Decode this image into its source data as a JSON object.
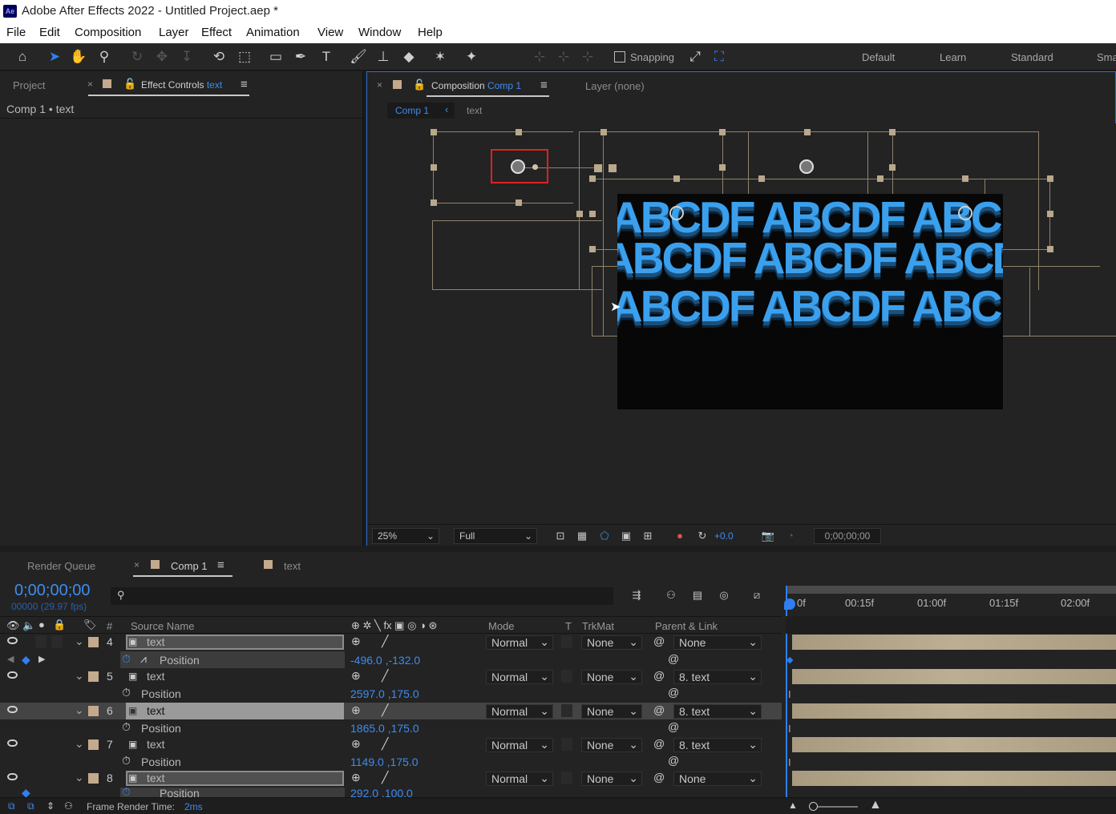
{
  "window": {
    "title": "Adobe After Effects 2022 - Untitled Project.aep *",
    "app_icon": "Ae"
  },
  "menu": [
    "File",
    "Edit",
    "Composition",
    "Layer",
    "Effect",
    "Animation",
    "View",
    "Window",
    "Help"
  ],
  "toolbar": {
    "snapping": "Snapping",
    "workspaces": [
      "Default",
      "Learn",
      "Standard",
      "Sma"
    ]
  },
  "left_panel": {
    "tab_project": "Project",
    "tab_effect_controls": "Effect Controls",
    "effect_target": "text",
    "breadcrumb": "Comp 1 • text"
  },
  "comp_panel": {
    "tab_label": "Composition",
    "comp_name": "Comp 1",
    "layer_tab": "Layer (none)",
    "nav_comp": "Comp 1",
    "nav_layer": "text"
  },
  "canvas": {
    "rows": [
      "ABCDF ABCDF ABCD",
      "ABCDF ABCDF ABCD",
      "ABCDF ABCDF ABCD"
    ]
  },
  "viewer_bar": {
    "zoom": "25%",
    "resolution": "Full",
    "exposure": "+0.0",
    "timecode": "0;00;00;00"
  },
  "timeline": {
    "tabs": [
      "Render Queue",
      "Comp 1",
      "text"
    ],
    "timecode": "0;00;00;00",
    "fps": "00000 (29.97 fps)",
    "headers": {
      "num": "#",
      "source": "Source Name",
      "mode": "Mode",
      "t": "T",
      "trkmat": "TrkMat",
      "parent": "Parent & Link"
    },
    "ruler": [
      "0f",
      "00:15f",
      "01:00f",
      "01:15f",
      "02:00f"
    ],
    "layers": [
      {
        "num": "4",
        "name": "text",
        "mode": "Normal",
        "trkmat": "None",
        "parent": "None",
        "prop": "Position",
        "value": "-496.0 ,-132.0"
      },
      {
        "num": "5",
        "name": "text",
        "mode": "Normal",
        "trkmat": "None",
        "parent": "8. text",
        "prop": "Position",
        "value": "2597.0 ,175.0"
      },
      {
        "num": "6",
        "name": "text",
        "mode": "Normal",
        "trkmat": "None",
        "parent": "8. text",
        "prop": "Position",
        "value": "1865.0 ,175.0"
      },
      {
        "num": "7",
        "name": "text",
        "mode": "Normal",
        "trkmat": "None",
        "parent": "8. text",
        "prop": "Position",
        "value": "1149.0 ,175.0"
      },
      {
        "num": "8",
        "name": "text",
        "mode": "Normal",
        "trkmat": "None",
        "parent": "None",
        "prop": "Position",
        "value": "292.0 ,100.0"
      }
    ],
    "status": {
      "label": "Frame Render Time:",
      "value": "2ms"
    }
  }
}
